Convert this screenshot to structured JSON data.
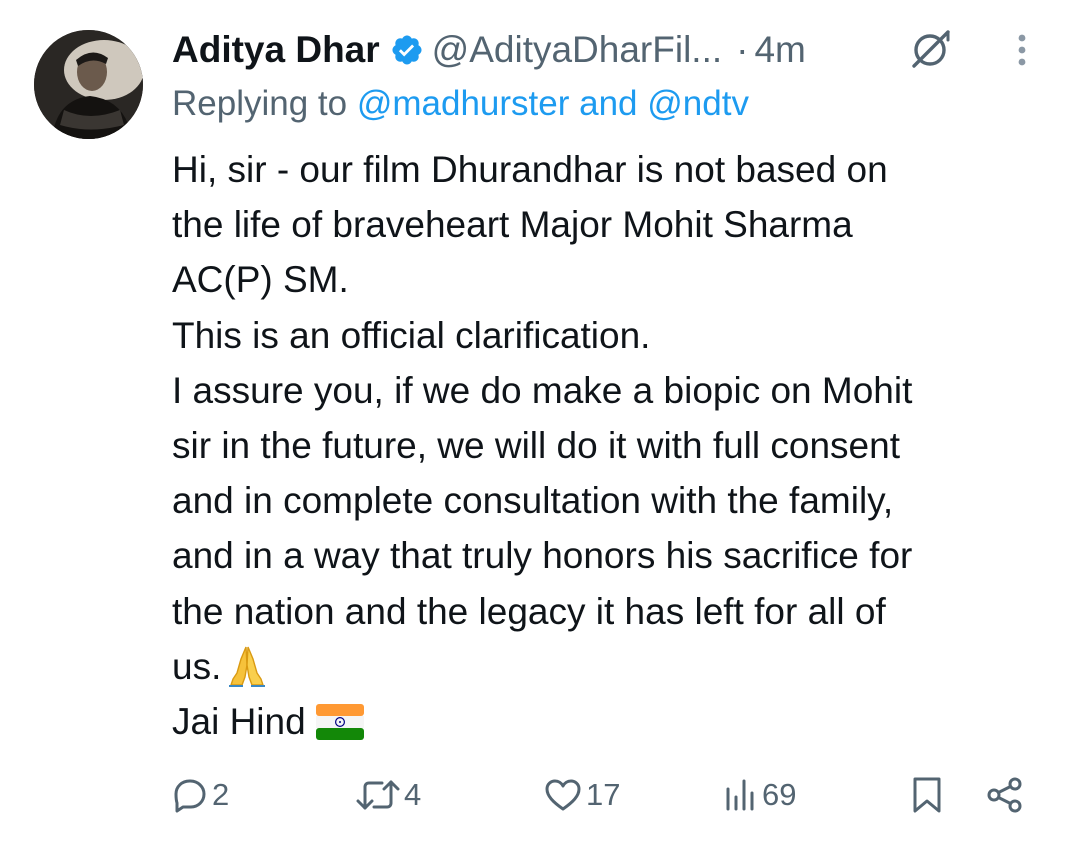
{
  "author": {
    "name": "Aditya Dhar",
    "handle": "@AdityaDharFil...",
    "separator": "·",
    "time": "4m",
    "verified": true
  },
  "reply": {
    "prefix": "Replying to",
    "mention1": "@madhurster",
    "conjunction": "and",
    "mention2": "@ndtv"
  },
  "body": {
    "lines": [
      "Hi, sir - our film Dhurandhar is not based on",
      "the life of braveheart Major Mohit Sharma",
      "AC(P) SM.",
      "This is an official clarification.",
      "I assure you, if we do make a biopic on Mohit",
      "sir in the future, we will do it with full consent",
      "and in complete consultation with the family,",
      "and in a way that truly honors his sacrifice for",
      "the nation and the legacy it has left for all of",
      "us.",
      "Jai Hind"
    ],
    "emoji_pray": "folded-hands-emoji",
    "emoji_flag": "india-flag-emoji"
  },
  "actions": {
    "replies": "2",
    "reposts": "4",
    "likes": "17",
    "views": "69"
  },
  "colors": {
    "text": "#0f1419",
    "secondary": "#536471",
    "link": "#1d9bf0",
    "verified": "#1d9bf0"
  },
  "icons": [
    "verified-badge-icon",
    "grok-icon",
    "more-icon",
    "reply-icon",
    "repost-icon",
    "like-icon",
    "views-icon",
    "bookmark-icon",
    "share-icon"
  ]
}
